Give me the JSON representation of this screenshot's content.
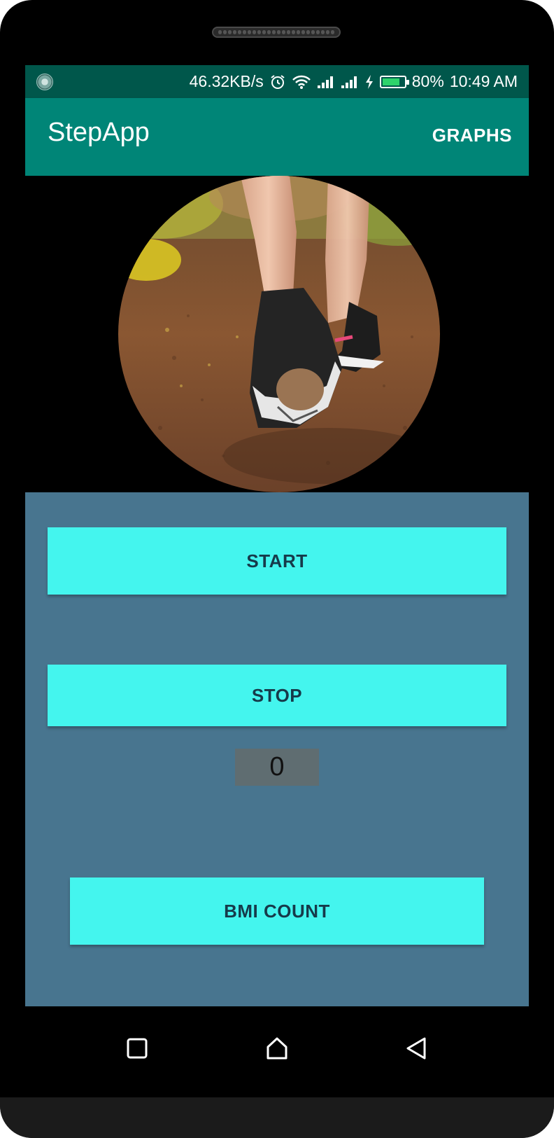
{
  "status_bar": {
    "network_speed": "46.32KB/s",
    "battery_percent": "80%",
    "time": "10:49 AM",
    "icons": [
      "loading-icon",
      "alarm-icon",
      "wifi-icon",
      "signal-icon",
      "signal-icon",
      "charging-icon",
      "battery-icon"
    ],
    "battery_level": 0.8,
    "battery_color": "#2ed36b"
  },
  "app_bar": {
    "title": "StepApp",
    "action_label": "GRAPHS",
    "color": "#008577"
  },
  "hero_image": {
    "description_icon": "walking-shoes-photo"
  },
  "controls": {
    "start_label": "START",
    "stop_label": "STOP",
    "step_count": "0",
    "bmi_label": "BMI COUNT",
    "button_color": "#44f5ee",
    "panel_color": "#48758f"
  },
  "nav_bar": {
    "items": [
      "recent-apps-icon",
      "home-icon",
      "back-icon"
    ]
  }
}
